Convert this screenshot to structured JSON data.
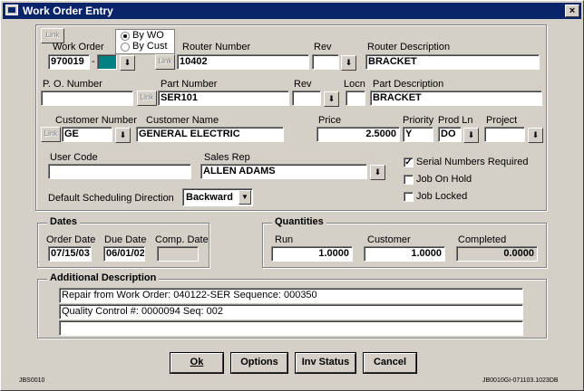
{
  "window": {
    "title": "Work Order Entry",
    "close_glyph": "×"
  },
  "common": {
    "link_label": "Link",
    "dropdown_glyph": "⬇"
  },
  "work_order": {
    "label": "Work Order",
    "value": "970019",
    "dash": "-",
    "radio_by_wo": "By WO",
    "radio_by_cust": "By Cust",
    "radio_selected": "By WO"
  },
  "router": {
    "number_label": "Router Number",
    "number_value": "10402",
    "rev_label": "Rev",
    "rev_value": "",
    "desc_label": "Router Description",
    "desc_value": "BRACKET"
  },
  "part": {
    "po_label": "P. O.  Number",
    "po_value": "",
    "number_label": "Part Number",
    "number_value": "SER101",
    "rev_label": "Rev",
    "rev_value": "",
    "locn_label": "Locn",
    "locn_value": "",
    "desc_label": "Part Description",
    "desc_value": "BRACKET"
  },
  "customer": {
    "number_label": "Customer Number",
    "number_value": "GE",
    "name_label": "Customer Name",
    "name_value": "GENERAL ELECTRIC",
    "price_label": "Price",
    "price_value": "2.5000",
    "priority_label": "Priority",
    "priority_value": "Y",
    "prodln_label": "Prod Ln",
    "prodln_value": "DO",
    "project_label": "Project",
    "project_value": ""
  },
  "misc": {
    "user_code_label": "User Code",
    "user_code_value": "",
    "sales_rep_label": "Sales Rep",
    "sales_rep_value": "ALLEN ADAMS",
    "sched_label": "Default Scheduling Direction",
    "sched_value": "Backward",
    "serial_label": "Serial Numbers Required",
    "onhold_label": "Job On Hold",
    "locked_label": "Job Locked",
    "check_mark": "✓"
  },
  "dates": {
    "title": "Dates",
    "order_label": "Order Date",
    "order_value": "07/15/03",
    "due_label": "Due Date",
    "due_value": "06/01/02",
    "comp_label": "Comp. Date",
    "comp_value": ""
  },
  "quantities": {
    "title": "Quantities",
    "run_label": "Run",
    "run_value": "1.0000",
    "customer_label": "Customer",
    "customer_value": "1.0000",
    "completed_label": "Completed",
    "completed_value": "0.0000"
  },
  "additional": {
    "title": "Additional Description",
    "line1": "Repair from Work Order: 040122-SER Sequence: 000350",
    "line2": "Quality Control #: 0000094 Seq: 002",
    "line3": ""
  },
  "buttons": {
    "ok": "Ok",
    "options": "Options",
    "inv_status": "Inv Status",
    "cancel": "Cancel"
  },
  "footer": {
    "left": "JBS0010",
    "right": "JB0010GI-071103.1023DB"
  }
}
